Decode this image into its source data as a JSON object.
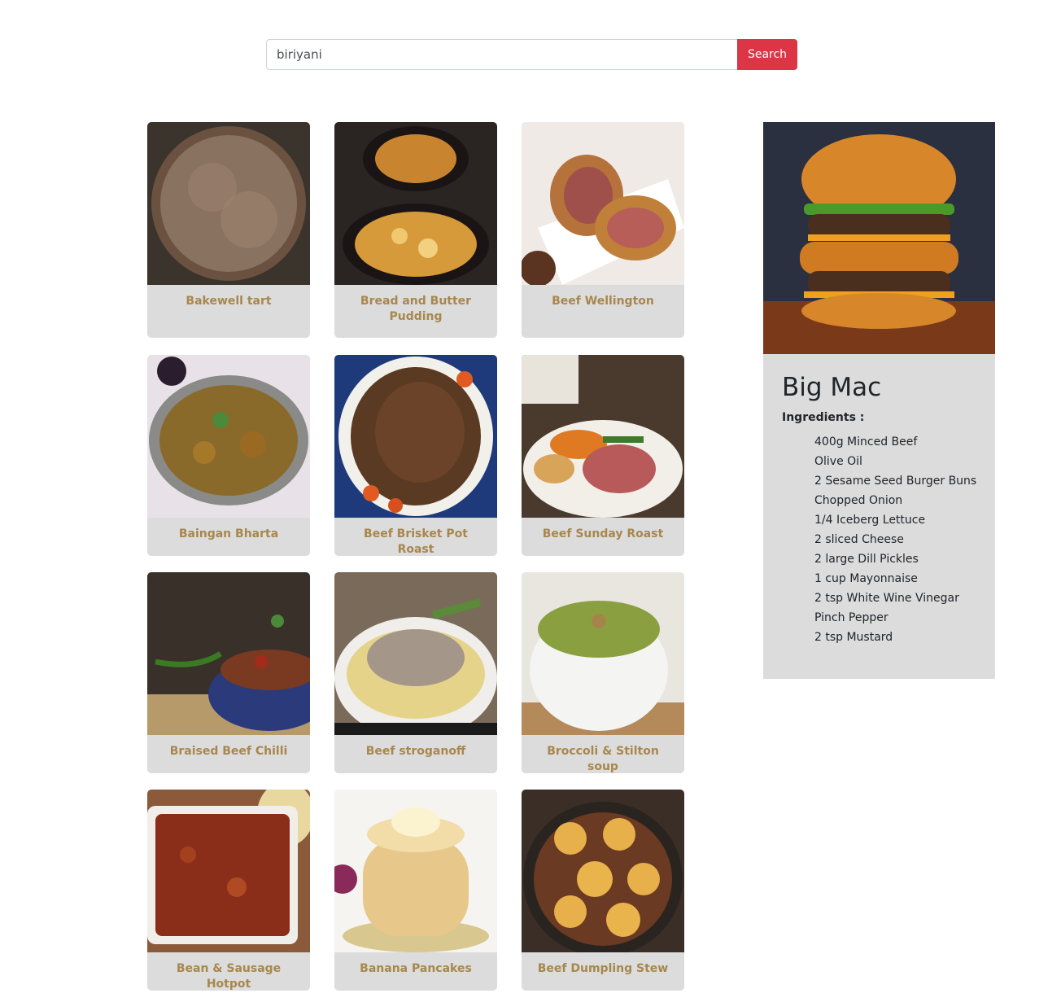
{
  "search": {
    "value": "biriyani",
    "button_label": "Search"
  },
  "meals": [
    {
      "title": "Bakewell tart",
      "image": "bakewell-tart-photo"
    },
    {
      "title": "Bread and Butter Pudding",
      "image": "bread-butter-pudding-photo"
    },
    {
      "title": "Beef Wellington",
      "image": "beef-wellington-photo"
    },
    {
      "title": "Baingan Bharta",
      "image": "baingan-bharta-photo"
    },
    {
      "title": "Beef Brisket Pot Roast",
      "image": "beef-brisket-pot-roast-photo"
    },
    {
      "title": "Beef Sunday Roast",
      "image": "beef-sunday-roast-photo"
    },
    {
      "title": "Braised Beef Chilli",
      "image": "braised-beef-chilli-photo"
    },
    {
      "title": "Beef stroganoff",
      "image": "beef-stroganoff-photo"
    },
    {
      "title": "Broccoli & Stilton soup",
      "image": "broccoli-stilton-soup-photo"
    },
    {
      "title": "Bean & Sausage Hotpot",
      "image": "bean-sausage-hotpot-photo"
    },
    {
      "title": "Banana Pancakes",
      "image": "banana-pancakes-photo"
    },
    {
      "title": "Beef Dumpling Stew",
      "image": "beef-dumpling-stew-photo"
    }
  ],
  "selected_meal": {
    "title": "Big Mac",
    "image": "big-mac-burger-photo",
    "ingredients_label": "Ingredients :",
    "ingredients": [
      "400g Minced Beef",
      "Olive Oil",
      "2 Sesame Seed Burger Buns",
      "Chopped Onion",
      "1/4 Iceberg Lettuce",
      "2 sliced Cheese",
      "2 large Dill Pickles",
      "1 cup Mayonnaise",
      "2 tsp White Wine Vinegar",
      "Pinch Pepper",
      "2 tsp Mustard"
    ]
  },
  "colors": {
    "accent_button": "#dc3545",
    "card_background": "#dcdcdc",
    "card_title": "#a7874d"
  }
}
